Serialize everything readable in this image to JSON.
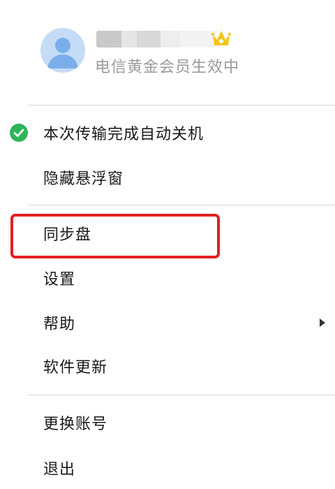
{
  "header": {
    "avatar_icon": "user-avatar-icon",
    "crown_icon": "crown-icon",
    "vip_status": "电信黄金会员生效中"
  },
  "menu": {
    "auto_shutdown": {
      "label": "本次传输完成自动关机",
      "checked": true,
      "icon": "check-circle-icon"
    },
    "hide_float": {
      "label": "隐藏悬浮窗"
    },
    "sync_disk": {
      "label": "同步盘"
    },
    "settings": {
      "label": "设置"
    },
    "help": {
      "label": "帮助",
      "icon": "chevron-right-icon"
    },
    "update": {
      "label": "软件更新"
    },
    "switch_account": {
      "label": "更换账号"
    },
    "exit": {
      "label": "退出"
    }
  },
  "colors": {
    "check_green": "#2eb45a",
    "highlight_red": "#e02020",
    "avatar_bg": "#c5dcf7",
    "avatar_fg": "#7aaeea",
    "crown_yellow": "#f5c518"
  }
}
